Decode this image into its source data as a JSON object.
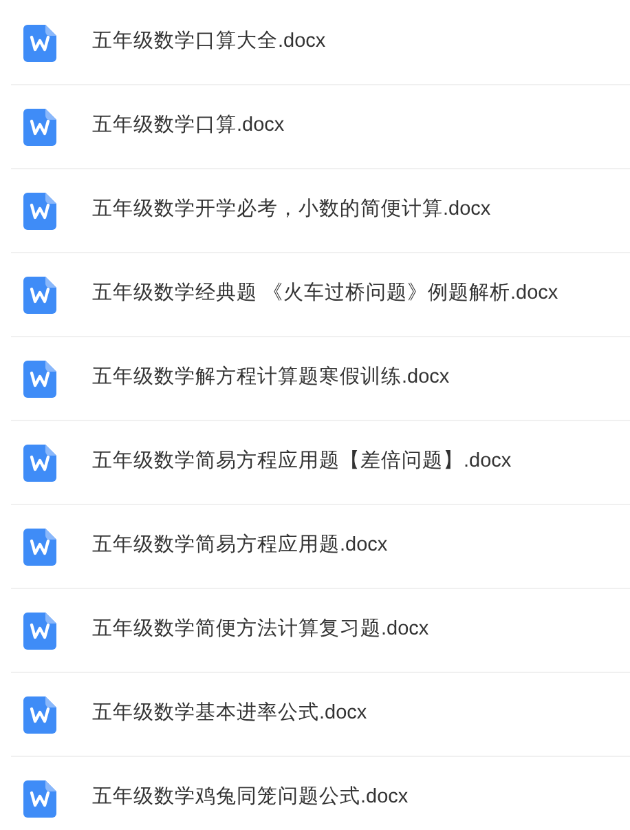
{
  "files": [
    {
      "name": "五年级数学口算大全.docx"
    },
    {
      "name": "五年级数学口算.docx"
    },
    {
      "name": "五年级数学开学必考，小数的简便计算.docx"
    },
    {
      "name": "五年级数学经典题 《火车过桥问题》例题解析.docx"
    },
    {
      "name": "五年级数学解方程计算题寒假训练.docx"
    },
    {
      "name": "五年级数学简易方程应用题【差倍问题】.docx"
    },
    {
      "name": "五年级数学简易方程应用题.docx"
    },
    {
      "name": "五年级数学简便方法计算复习题.docx"
    },
    {
      "name": "五年级数学基本进率公式.docx"
    },
    {
      "name": "五年级数学鸡兔同笼问题公式.docx"
    }
  ]
}
